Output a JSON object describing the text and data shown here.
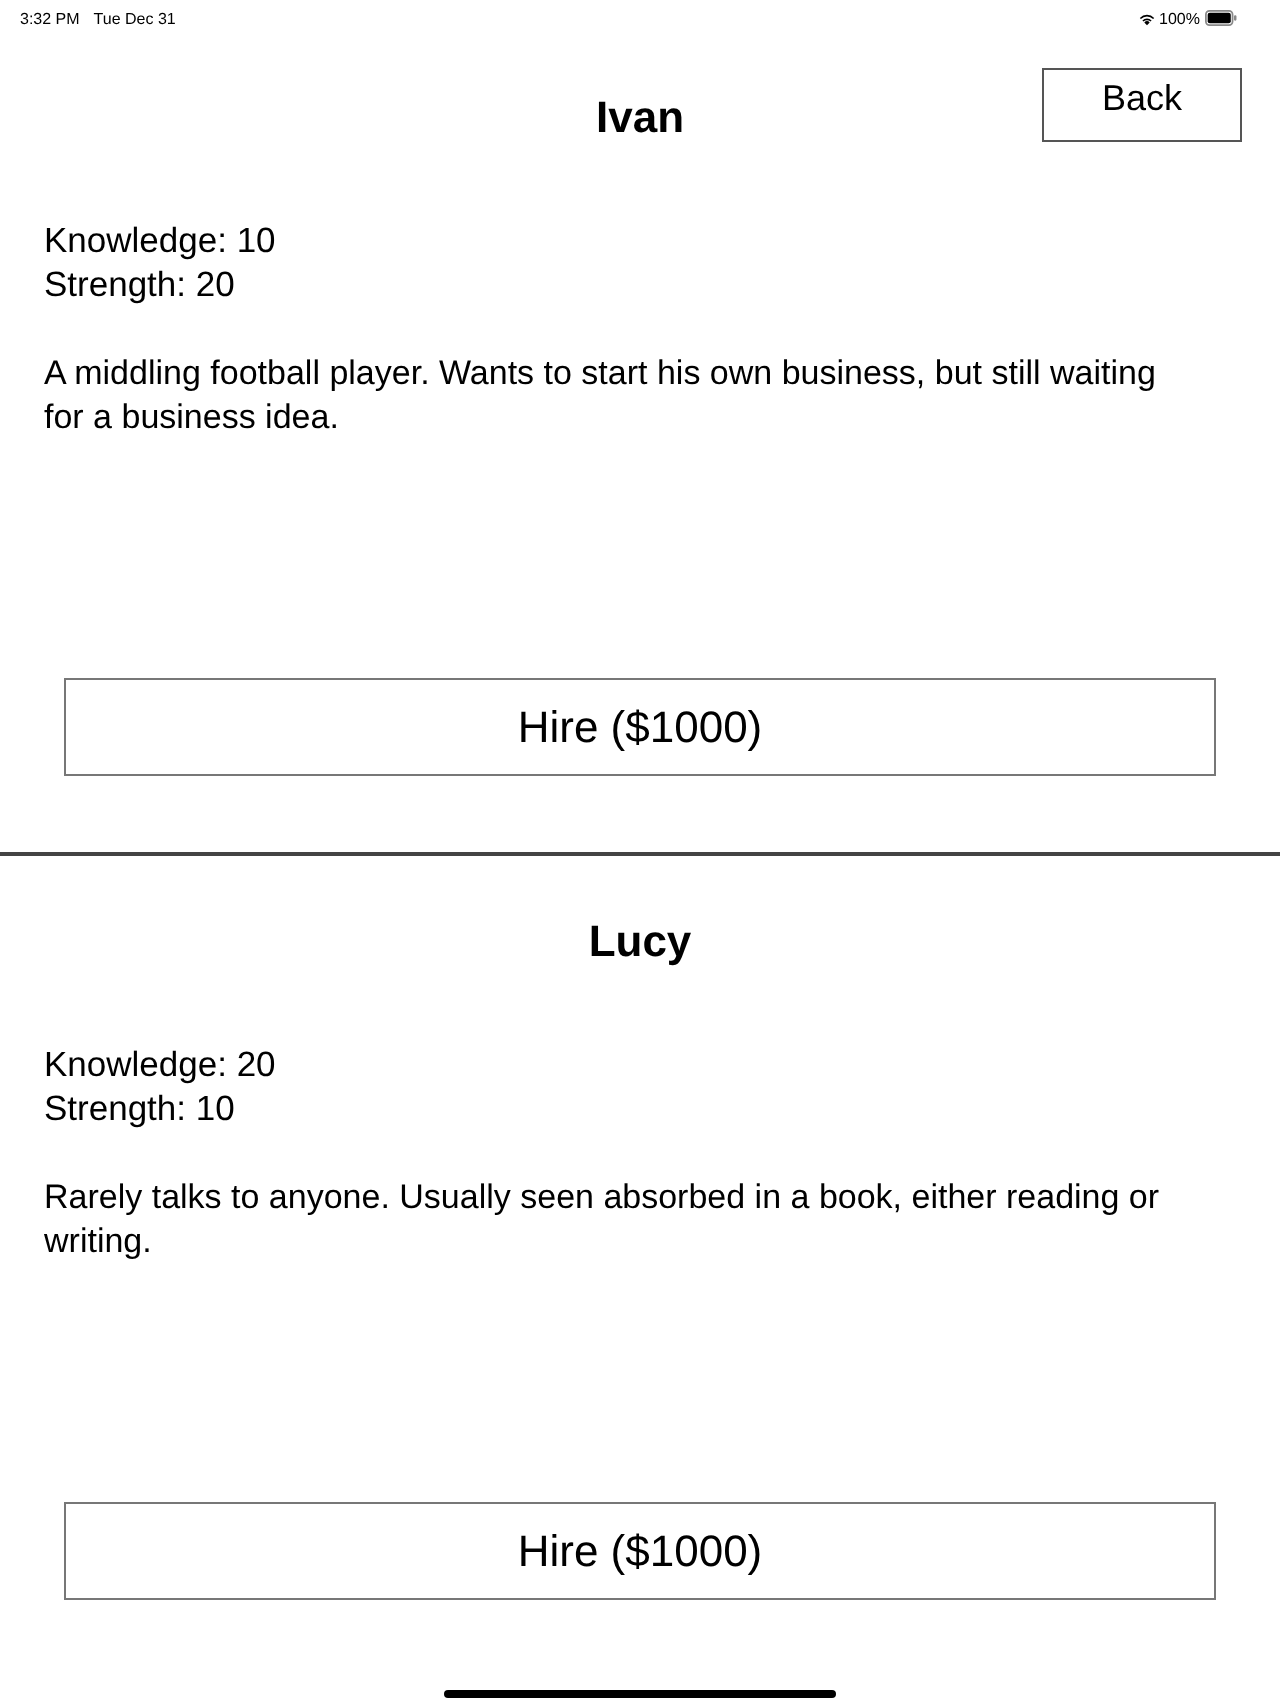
{
  "status_bar": {
    "time": "3:32 PM",
    "date": "Tue Dec 31",
    "battery_text": "100%"
  },
  "back_button": {
    "label": "Back"
  },
  "candidates": [
    {
      "name": "Ivan",
      "stats": [
        "Knowledge: 10",
        "Strength: 20"
      ],
      "description": "A middling football player. Wants to start his own business, but still waiting for a business idea.",
      "hire_label": "Hire ($1000)"
    },
    {
      "name": "Lucy",
      "stats": [
        "Knowledge: 20",
        "Strength: 10"
      ],
      "description": "Rarely talks to anyone. Usually seen absorbed in a book, either reading or writing.",
      "hire_label": "Hire ($1000)"
    }
  ]
}
